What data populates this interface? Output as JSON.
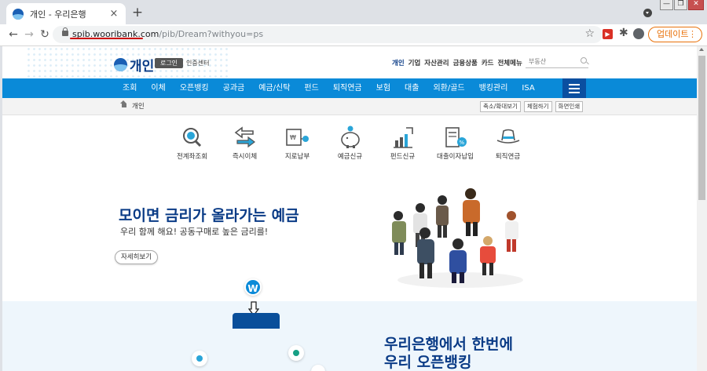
{
  "browser": {
    "tab_title": "개인 - 우리은행",
    "tab_close": "×",
    "new_tab": "+",
    "window_buttons": [
      "—",
      "❐",
      "✕"
    ],
    "url_host": "spib.wooribank.com",
    "url_path": "/pib/Dream?withyou=ps",
    "update_label": "업데이트",
    "update_menu": "⋮",
    "back_glyph": "←",
    "forward_glyph": "→",
    "reload_glyph": "↻",
    "star_glyph": "☆",
    "puzzle_glyph": "✱"
  },
  "header": {
    "logo_text": "개인",
    "login_label": "로그인",
    "cert_label": "인증센터",
    "topnav": [
      "개인",
      "기업",
      "자산관리",
      "금융상품",
      "카드",
      "전체메뉴"
    ],
    "search_placeholder": "부동산"
  },
  "gnb": [
    "조회",
    "이체",
    "오픈뱅킹",
    "공과금",
    "예금/신탁",
    "펀드",
    "퇴직연금",
    "보험",
    "대출",
    "외환/골드",
    "뱅킹관리",
    "ISA"
  ],
  "breadcrumb": {
    "current": "개인",
    "util_buttons": [
      "축소/확대보기",
      "체험하기",
      "화면인쇄"
    ]
  },
  "quick_menu": [
    {
      "label": "전계좌조회",
      "icon": "account-search-icon"
    },
    {
      "label": "즉시이체",
      "icon": "transfer-arrows-icon"
    },
    {
      "label": "지로납부",
      "icon": "giro-payment-icon"
    },
    {
      "label": "예금신규",
      "icon": "piggy-bank-icon"
    },
    {
      "label": "펀드신규",
      "icon": "fund-chart-icon"
    },
    {
      "label": "대출이자납입",
      "icon": "loan-calculator-icon"
    },
    {
      "label": "퇴직연금",
      "icon": "pension-hat-icon"
    }
  ],
  "hero": {
    "title": "모이면 금리가 올라가는 예금",
    "subtitle": "우리 함께 해요! 공동구매로 높은 금리를!",
    "detail_button": "자세히보기"
  },
  "section2": {
    "title_line1": "우리은행에서 한번에",
    "title_line2": "우리 오픈뱅킹",
    "badge": "W"
  },
  "colors": {
    "brand_navy": "#0a3b86",
    "gnb_blue": "#0a8ad8",
    "update_orange": "#e8710a",
    "annotation_red": "#c00000"
  }
}
